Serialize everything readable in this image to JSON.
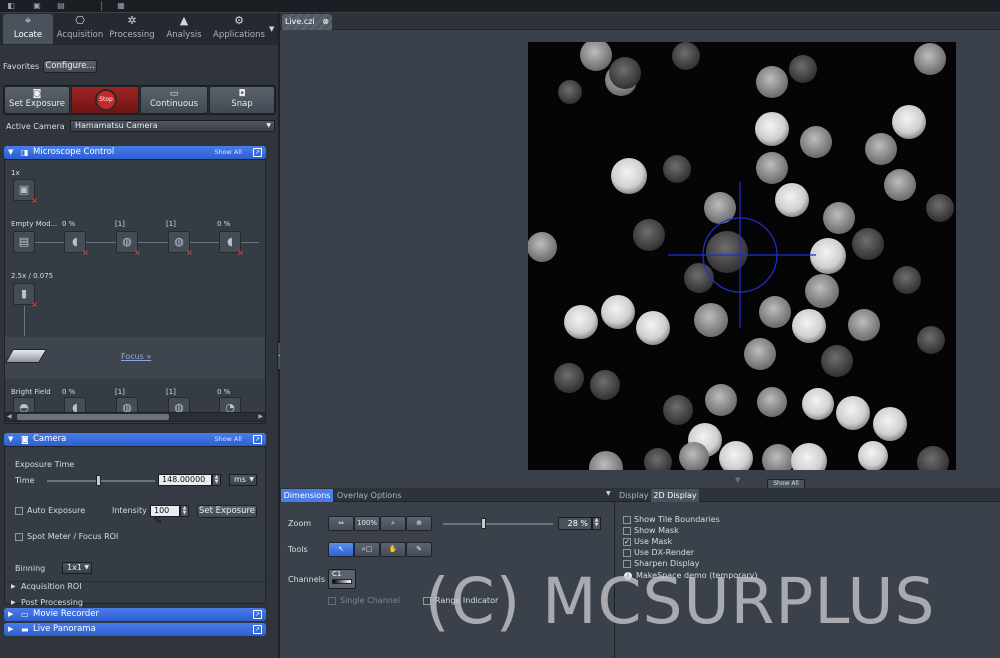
{
  "tabs": [
    {
      "label": "Locate",
      "icon": "locate-icon",
      "glyph": "⌖"
    },
    {
      "label": "Acquisition",
      "icon": "acquisition-icon",
      "glyph": "⎔"
    },
    {
      "label": "Processing",
      "icon": "processing-icon",
      "glyph": "✲"
    },
    {
      "label": "Analysis",
      "icon": "analysis-icon",
      "glyph": "▲"
    },
    {
      "label": "Applications",
      "icon": "applications-icon",
      "glyph": "⚙"
    }
  ],
  "favorites": {
    "label": "Favorites",
    "configure": "Configure..."
  },
  "acquire_buttons": {
    "set_exposure": "Set Exposure",
    "stop": "Stop",
    "continuous": "Continuous",
    "snap": "Snap"
  },
  "active_camera": {
    "label": "Active Camera",
    "value": "Hamamatsu Camera"
  },
  "microscope": {
    "title": "Microscope Control",
    "show_all": "Show All",
    "zoom": "1x",
    "row1": {
      "first": "Empty Mod...",
      "values": [
        "0 %",
        "[1]",
        "[1]",
        "0 %"
      ]
    },
    "objective": "2.5x / 0.075",
    "focus": "Focus »",
    "row2": {
      "first": "Bright Field",
      "values": [
        "0 %",
        "[1]",
        "[1]",
        "0 %"
      ]
    }
  },
  "camera": {
    "title": "Camera",
    "show_all": "Show All",
    "exposure_time": "Exposure Time",
    "time_label": "Time",
    "time_value": "148.00000",
    "unit": "ms",
    "auto_exposure": "Auto Exposure",
    "intensity_label": "Intensity",
    "intensity_value": "100 %",
    "set_exposure": "Set Exposure",
    "spot_meter": "Spot Meter / Focus ROI",
    "binning_label": "Binning",
    "binning_value": "1x1",
    "acquisition_roi": "Acquisition ROI",
    "post_processing": "Post Processing"
  },
  "movie_recorder": {
    "title": "Movie Recorder"
  },
  "live_panorama": {
    "title": "Live Panorama"
  },
  "document_tab": "Live.czi",
  "show_all_bottom": "Show All",
  "bottom_tabs": {
    "dimensions": "Dimensions",
    "overlay": "Overlay Options",
    "display": "Display",
    "display2d": "2D Display"
  },
  "dimensions": {
    "zoom_label": "Zoom",
    "zoom_btns": [
      "⇔",
      "100%",
      "⌕",
      "⊕"
    ],
    "zoom_value": "28 %",
    "tools_label": "Tools",
    "tools_btns": [
      "↖",
      "⌕▢",
      "✋",
      "✎"
    ],
    "channels_label": "Channels",
    "channel": "C1",
    "single_channel": "Single Channel",
    "range_indicator": "Range Indicator"
  },
  "display2d": {
    "options": [
      {
        "label": "Show Tile Boundaries",
        "checked": false
      },
      {
        "label": "Show Mask",
        "checked": false
      },
      {
        "label": "Use Mask",
        "checked": true
      },
      {
        "label": "Use DX-Render",
        "checked": false
      },
      {
        "label": "Sharpen Display",
        "checked": false
      }
    ],
    "makespace": "MakeSpace demo (temporary)"
  },
  "watermark": "(C) MCSURPLUS"
}
